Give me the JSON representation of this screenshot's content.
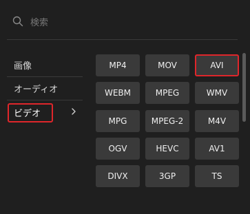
{
  "search": {
    "placeholder": "検索",
    "icon": "search-icon"
  },
  "sidebar": {
    "items": [
      {
        "label": "画像"
      },
      {
        "label": "オーディオ"
      },
      {
        "label": "ビデオ",
        "active": true,
        "chevron": "chevron-right-icon"
      }
    ]
  },
  "formats": [
    {
      "label": "MP4"
    },
    {
      "label": "MOV"
    },
    {
      "label": "AVI",
      "selected": true
    },
    {
      "label": "WEBM"
    },
    {
      "label": "MPEG"
    },
    {
      "label": "WMV"
    },
    {
      "label": "MPG"
    },
    {
      "label": "MPEG-2"
    },
    {
      "label": "M4V"
    },
    {
      "label": "OGV"
    },
    {
      "label": "HEVC"
    },
    {
      "label": "AV1"
    },
    {
      "label": "DIVX"
    },
    {
      "label": "3GP"
    },
    {
      "label": "TS"
    }
  ],
  "colors": {
    "background": "#1f1f1f",
    "button": "#3a3a3a",
    "highlight": "#e0262b"
  }
}
